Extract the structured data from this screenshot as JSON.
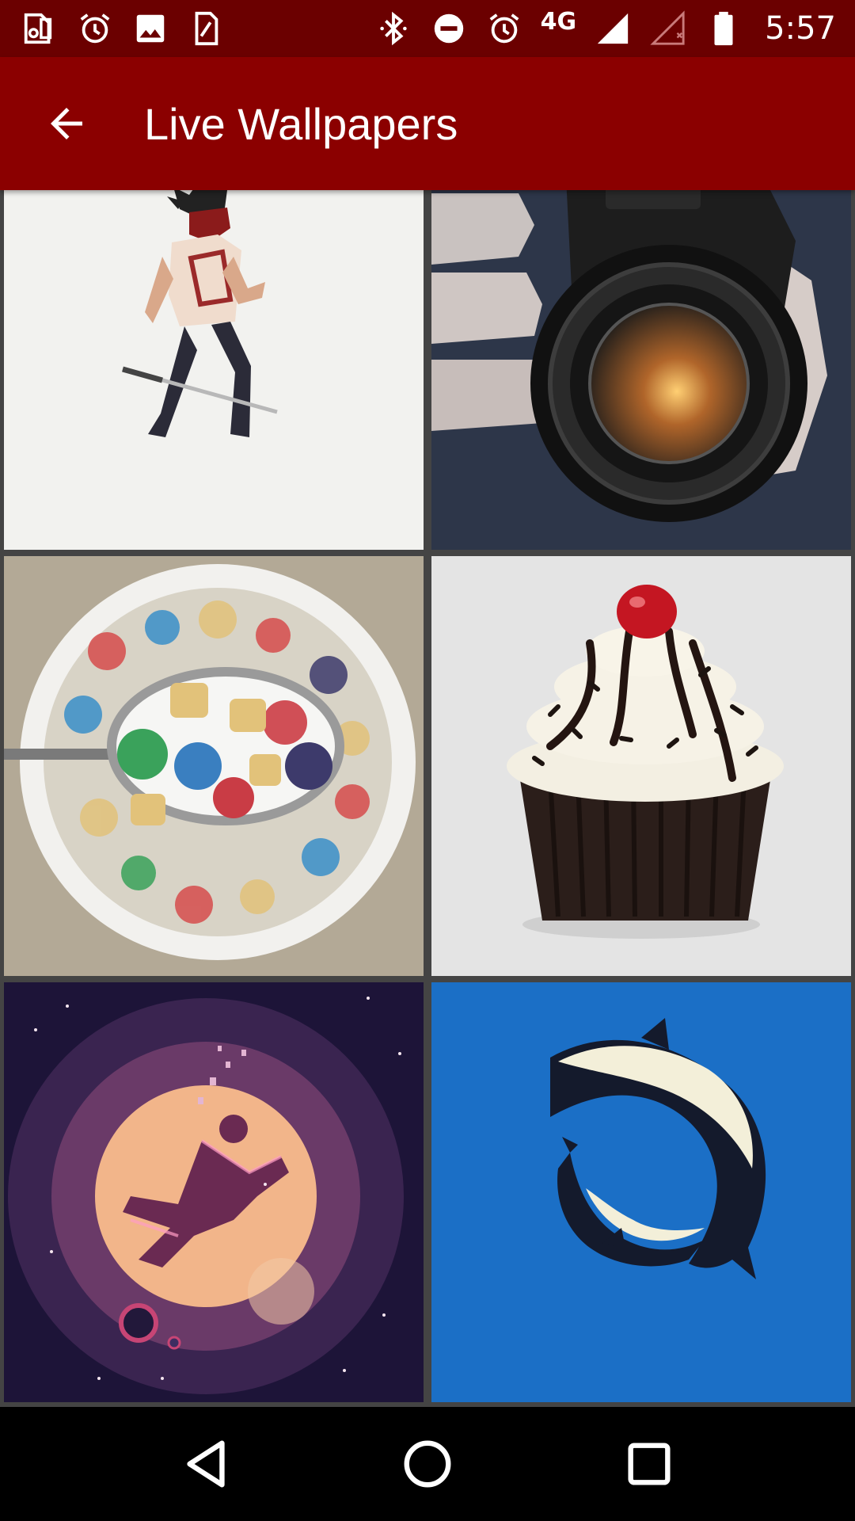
{
  "status_bar": {
    "network_type": "4G",
    "time": "5:57",
    "left_icons": [
      "sd-card-icon",
      "alarm-icon",
      "image-icon",
      "sim-icon"
    ],
    "right_icons": [
      "bluetooth-icon",
      "do-not-disturb-icon",
      "alarm-icon",
      "signal-icon",
      "signal-empty-icon",
      "battery-icon"
    ],
    "background_color": "#6b0000"
  },
  "app_bar": {
    "title": "Live Wallpapers",
    "back_icon": "arrow-back-icon",
    "background_color": "#8b0000"
  },
  "wallpapers": [
    {
      "name": "Samurai character",
      "background": "#f2f2ef"
    },
    {
      "name": "Camera lens",
      "background": "#2b3446"
    },
    {
      "name": "Cereal bowl",
      "background": "#b3a996"
    },
    {
      "name": "Cupcake",
      "background": "#e3e3e3"
    },
    {
      "name": "Space diver",
      "background": "#1d1438"
    },
    {
      "name": "Orcas",
      "background": "#1b6fc6"
    }
  ],
  "nav_bar": {
    "buttons": [
      "back-triangle-icon",
      "home-circle-icon",
      "recents-square-icon"
    ]
  }
}
